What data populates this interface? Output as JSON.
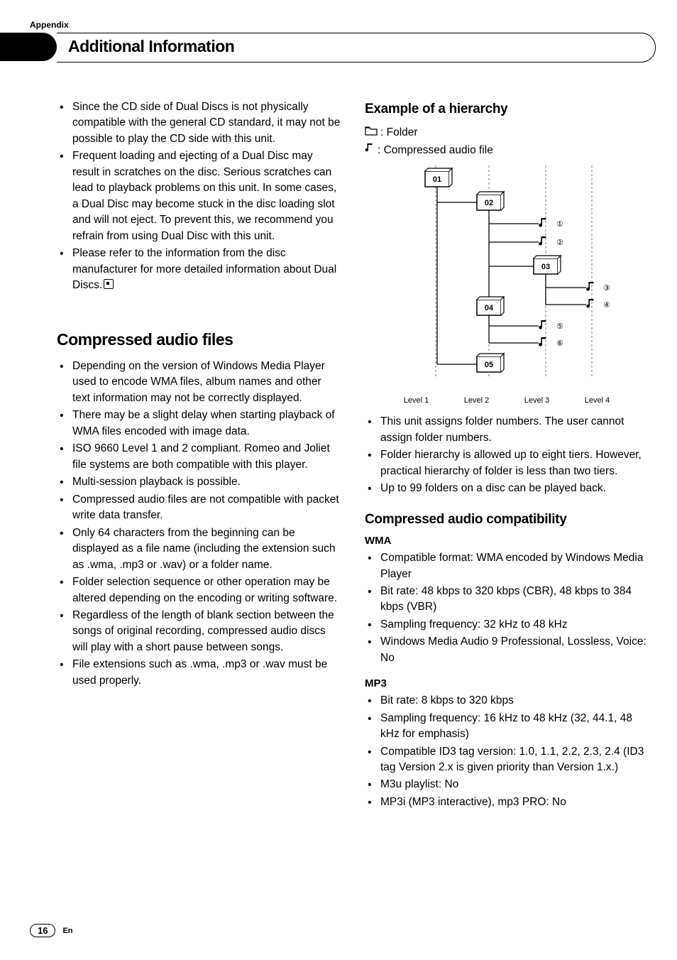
{
  "appendix_label": "Appendix",
  "header_title": "Additional Information",
  "col_left": {
    "top_bullets": [
      "Since the CD side of Dual Discs is not physically compatible with the general CD standard, it may not be possible to play the CD side with this unit.",
      "Frequent loading and ejecting of a Dual Disc may result in scratches on the disc. Serious scratches can lead to playback problems on this unit. In some cases, a Dual Disc may become stuck in the disc loading slot and will not eject. To prevent this, we recommend you refrain from using Dual Disc with this unit.",
      "Please refer to the information from the disc manufacturer for more detailed information about Dual Discs."
    ],
    "section_title": "Compressed audio files",
    "section_bullets": [
      "Depending on the version of Windows Media Player used to encode WMA files, album names and other text information may not be correctly displayed.",
      "There may be a slight delay when starting playback of WMA files encoded with image data.",
      "ISO 9660 Level 1 and 2 compliant. Romeo and Joliet file systems are both compatible with this player.",
      "Multi-session playback is possible.",
      "Compressed audio files are not compatible with packet write data transfer.",
      "Only 64 characters from the beginning can be displayed as a file name (including the extension such as .wma, .mp3 or .wav) or a folder name.",
      "Folder selection sequence or other operation may be altered depending on the encoding or writing software.",
      "Regardless of the length of blank section between the songs of original recording, compressed audio discs will play with a short pause between songs.",
      "File extensions such as .wma, .mp3 or .wav must be used properly."
    ]
  },
  "col_right": {
    "example_heading": "Example of a hierarchy",
    "legend_folder": ": Folder",
    "legend_file": ": Compressed audio file",
    "diagram": {
      "folders": [
        "01",
        "02",
        "03",
        "04",
        "05"
      ],
      "file_marks": [
        "1",
        "2",
        "3",
        "4",
        "5",
        "6"
      ],
      "levels": [
        "Level 1",
        "Level 2",
        "Level 3",
        "Level 4"
      ]
    },
    "hier_bullets": [
      "This unit assigns folder numbers. The user cannot assign folder numbers.",
      "Folder hierarchy is allowed up to eight tiers. However, practical hierarchy of folder is less than two tiers.",
      "Up to 99 folders on a disc can be played back."
    ],
    "compat_heading": "Compressed audio compatibility",
    "wma_heading": "WMA",
    "wma_bullets": [
      "Compatible format: WMA encoded by Windows Media Player",
      "Bit rate: 48 kbps to 320 kbps (CBR), 48 kbps to 384 kbps (VBR)",
      "Sampling frequency: 32 kHz to 48 kHz",
      "Windows Media Audio 9 Professional, Lossless, Voice: No"
    ],
    "mp3_heading": "MP3",
    "mp3_bullets": [
      "Bit rate: 8 kbps to 320 kbps",
      "Sampling frequency: 16 kHz to 48 kHz (32, 44.1, 48 kHz for emphasis)",
      "Compatible ID3 tag version: 1.0, 1.1, 2.2, 2.3, 2.4 (ID3 tag Version 2.x is given priority than Version 1.x.)",
      "M3u playlist: No",
      "MP3i (MP3 interactive), mp3 PRO: No"
    ]
  },
  "page_number": "16",
  "lang": "En"
}
